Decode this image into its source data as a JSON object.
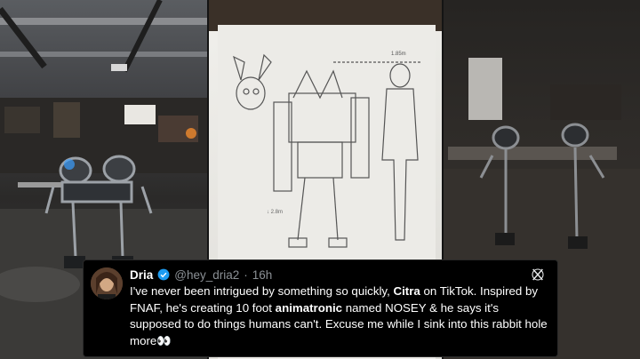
{
  "tweet": {
    "author_name": "Dria",
    "handle": "@hey_dria2",
    "separator": "·",
    "time": "16h",
    "text_parts": [
      {
        "text": "I've never been intrigued by something so quickly, ",
        "bold": false
      },
      {
        "text": "Citra",
        "bold": true
      },
      {
        "text": " on TikTok. Inspired by FNAF, he's creating 10 foot ",
        "bold": false
      },
      {
        "text": "animatronic",
        "bold": true
      },
      {
        "text": " named NOSEY & he says it's supposed to do things humans can't. Excuse me while I sink into this rabbit hole more",
        "bold": false
      },
      {
        "text": "👀",
        "bold": false
      }
    ]
  },
  "sketch": {
    "height_note": "1.85m",
    "side_note": "↓ 2.8m"
  },
  "colors": {
    "tweet_bg": "#000000",
    "verified": "#1d9bf0",
    "handle_gray": "#8b9095"
  },
  "icons": [
    "verified-badge-icon",
    "x-logo-icon"
  ]
}
